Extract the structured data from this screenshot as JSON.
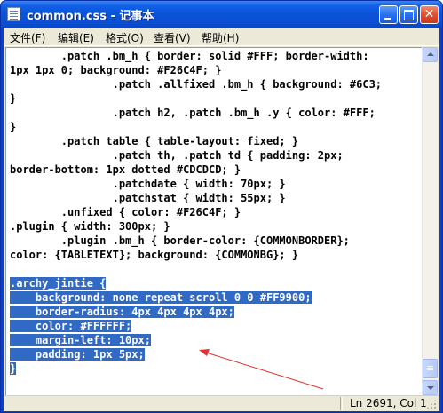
{
  "window": {
    "title": "common.css - 记事本",
    "icon": "notepad-icon"
  },
  "titlebar_buttons": {
    "minimize": "minimize-icon",
    "maximize": "maximize-icon",
    "close": "close-icon",
    "close_glyph": "✕"
  },
  "menu": {
    "items": [
      {
        "label": "文件(F)"
      },
      {
        "label": "编辑(E)"
      },
      {
        "label": "格式(O)"
      },
      {
        "label": "查看(V)"
      },
      {
        "label": "帮助(H)"
      }
    ]
  },
  "editor": {
    "lines": [
      {
        "text": "        .patch .bm_h { border: solid #FFF; border-width:",
        "selected": false
      },
      {
        "text": "1px 1px 0; background: #F26C4F; }",
        "selected": false
      },
      {
        "text": "                .patch .allfixed .bm_h { background: #6C3;",
        "selected": false
      },
      {
        "text": "}",
        "selected": false
      },
      {
        "text": "                .patch h2, .patch .bm_h .y { color: #FFF;",
        "selected": false
      },
      {
        "text": "}",
        "selected": false
      },
      {
        "text": "        .patch table { table-layout: fixed; }",
        "selected": false
      },
      {
        "text": "                .patch th, .patch td { padding: 2px;",
        "selected": false
      },
      {
        "text": "border-bottom: 1px dotted #CDCDCD; }",
        "selected": false
      },
      {
        "text": "                .patchdate { width: 70px; }",
        "selected": false
      },
      {
        "text": "                .patchstat { width: 55px; }",
        "selected": false
      },
      {
        "text": "        .unfixed { color: #F26C4F; }",
        "selected": false
      },
      {
        "text": ".plugin { width: 300px; }",
        "selected": false
      },
      {
        "text": "        .plugin .bm_h { border-color: {COMMONBORDER};",
        "selected": false
      },
      {
        "text": "color: {TABLETEXT}; background: {COMMONBG}; }",
        "selected": false
      },
      {
        "text": "",
        "selected": false
      },
      {
        "text": ".archy_jintie {",
        "selected": true
      },
      {
        "text": "    background: none repeat scroll 0 0 #FF9900;",
        "selected": true
      },
      {
        "text": "    border-radius: 4px 4px 4px 4px;",
        "selected": true
      },
      {
        "text": "    color: #FFFFFF;",
        "selected": true
      },
      {
        "text": "    margin-left: 10px;",
        "selected": true
      },
      {
        "text": "    padding: 1px 5px;",
        "selected": true
      },
      {
        "text": "}",
        "selected": true
      }
    ],
    "selection_color": "#316AC5",
    "annotation_arrow_color": "#E03030"
  },
  "status": {
    "position": "Ln 2691, Col 1"
  }
}
